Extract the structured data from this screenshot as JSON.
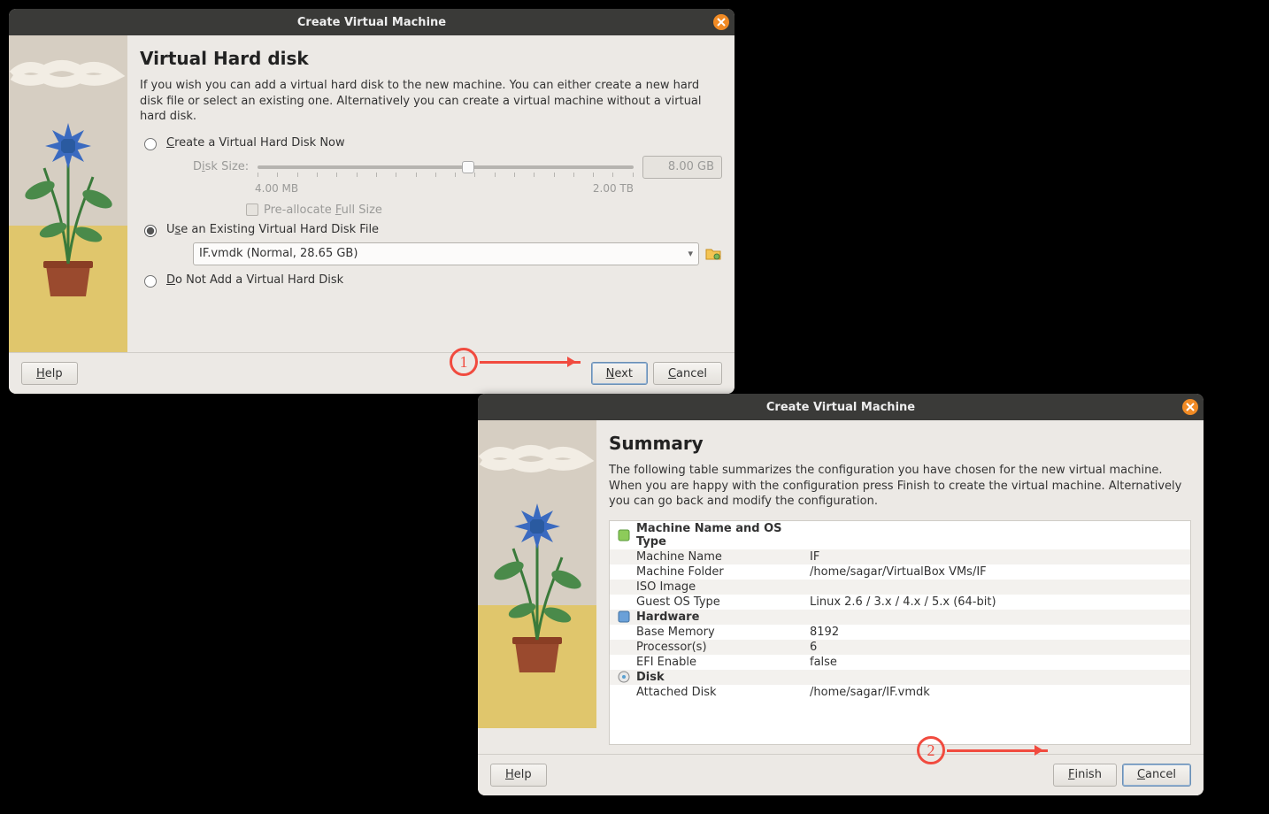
{
  "window1": {
    "title": "Create Virtual Machine",
    "page_title": "Virtual Hard disk",
    "description": "If you wish you can add a virtual hard disk to the new machine. You can either create a new hard disk file or select an existing one. Alternatively you can create a virtual machine without a virtual hard disk.",
    "radio_create": "Create a Virtual Hard Disk Now",
    "disk_size_label": "Disk Size:",
    "disk_size_value": "8.00 GB",
    "min_size": "4.00 MB",
    "max_size": "2.00 TB",
    "prealloc": "Pre-allocate Full Size",
    "radio_existing": "Use an Existing Virtual Hard Disk File",
    "combo_value": "IF.vmdk (Normal, 28.65 GB)",
    "radio_none": "Do Not Add a Virtual Hard Disk",
    "help": "Help",
    "next": "Next",
    "cancel": "Cancel"
  },
  "window2": {
    "title": "Create Virtual Machine",
    "page_title": "Summary",
    "description": "The following table summarizes the configuration you have chosen for the new virtual machine. When you are happy with the configuration press Finish to create the virtual machine. Alternatively you can go back and modify the configuration.",
    "section_name": "Machine Name and OS Type",
    "row_machine_name_k": "Machine Name",
    "row_machine_name_v": "IF",
    "row_folder_k": "Machine Folder",
    "row_folder_v": "/home/sagar/VirtualBox VMs/IF",
    "row_iso_k": "ISO Image",
    "row_iso_v": "",
    "row_os_k": "Guest OS Type",
    "row_os_v": "Linux 2.6 / 3.x / 4.x / 5.x (64-bit)",
    "section_hw": "Hardware",
    "row_mem_k": "Base Memory",
    "row_mem_v": "8192",
    "row_proc_k": "Processor(s)",
    "row_proc_v": "6",
    "row_efi_k": "EFI Enable",
    "row_efi_v": "false",
    "section_disk": "Disk",
    "row_disk_k": "Attached Disk",
    "row_disk_v": "/home/sagar/IF.vmdk",
    "help": "Help",
    "finish": "Finish",
    "cancel": "Cancel"
  },
  "callouts": {
    "one": "1",
    "two": "2"
  }
}
